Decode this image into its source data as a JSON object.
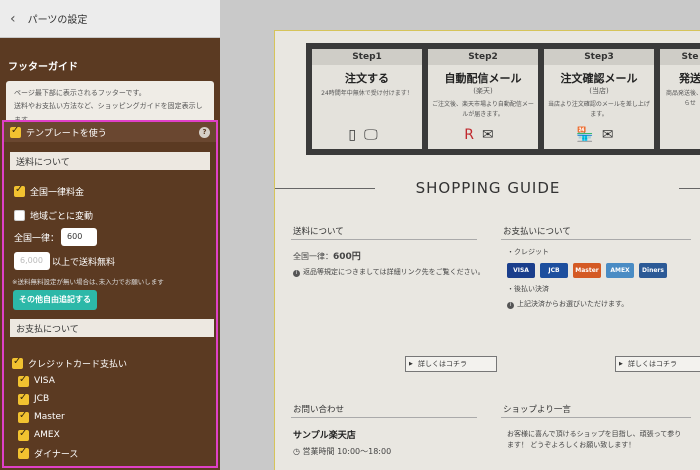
{
  "header": {
    "back_icon": "chevron-left-icon",
    "title": "パーツの設定"
  },
  "footer_guide": {
    "title": "フッターガイド",
    "desc1": "ページ最下部に表示されるフッターです。",
    "desc2": "送料やお支払い方法など、ショッピングガイドを固定表示します。"
  },
  "template": {
    "use_label": "テンプレートを使う",
    "help": "?",
    "shipping": {
      "label": "送料について",
      "flat_label": "全国一律料金",
      "region_label": "地域ごとに変動",
      "flat_field_label": "全国一律：",
      "flat_value": "600",
      "free_placeholder": "6,000",
      "free_suffix": "以上で送料無料",
      "note": "※送料無料設定が無い場合は､未入力でお願いします",
      "add_button": "その他自由追記する"
    },
    "payment": {
      "label": "お支払について",
      "credit_label": "クレジットカード支払い",
      "cards": [
        "VISA",
        "JCB",
        "Master",
        "AMEX",
        "ダイナース"
      ]
    }
  },
  "preview": {
    "steps": [
      {
        "step": "Step1",
        "title": "注文する",
        "sub": "24時間年中無休で受け付けます！"
      },
      {
        "step": "Step2",
        "title": "自動配信メール",
        "title2": "(楽天)",
        "sub": "ご注文後、楽天市場より自動配信メールが届きます。"
      },
      {
        "step": "Step3",
        "title": "注文確認メール",
        "title2": "(当店)",
        "sub": "当店より注文確認のメールを差し上げます。"
      },
      {
        "step": "Ste",
        "title": "発送",
        "sub": "商品発送後、お知らせ"
      }
    ],
    "guide_title": "SHOPPING GUIDE",
    "shipping_title": "送料について",
    "shipping_text": "全国一律：",
    "shipping_price": "600円",
    "shipping_note": "返品等規定につきましては詳細リンク先をご覧ください。",
    "payment_title": "お支払いについて",
    "credit": "・クレジット",
    "card_logos": [
      "VISA",
      "JCB",
      "Master",
      "AMEX",
      "Diners"
    ],
    "deferred": "・後払い決済",
    "deferred_note": "上記決済からお選びいただけます。",
    "detail_button": "詳しくはコチラ",
    "contact_title": "お問い合わせ",
    "shop_name": "サンプル楽天店",
    "hours": "営業時間 10:00～18:00",
    "shop_msg_title": "ショップより一言",
    "shop_msg1": "お客様に喜んで頂けるショップを目指し、頑張って参ります！ どうぞよろしくお願い致します！"
  },
  "colors": {
    "panel": "#5b3a22",
    "highlight": "#e040c8",
    "check": "#f2c230",
    "add_button": "#2cb8a8"
  }
}
